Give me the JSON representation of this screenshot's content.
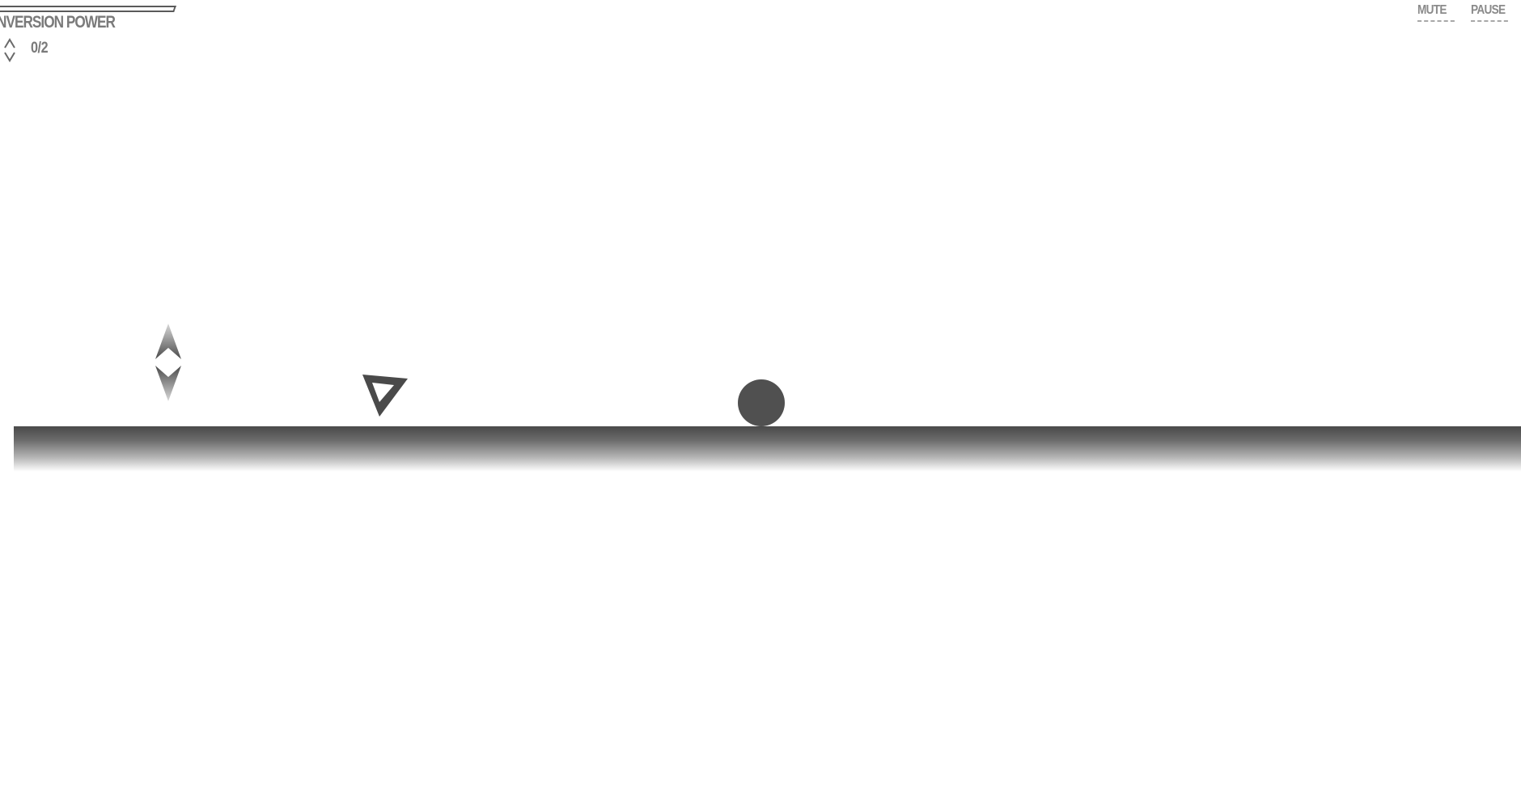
{
  "hud": {
    "power_label": "NVERSION POWER",
    "power_fill_percent": 0,
    "gem_icon": "double-chevron-gem-icon",
    "gems_collected": "0/2",
    "mute_label": "MUTE",
    "pause_label": "PAUSE"
  },
  "world": {
    "gem_icon": "diamond-gem-icon",
    "player_icon": "triangle-player-icon",
    "enemy_icon": "ball-icon"
  },
  "colors": {
    "primary": "#5a5a5a",
    "text": "#7a7a7a",
    "ball": "#505050",
    "background": "#ffffff"
  }
}
